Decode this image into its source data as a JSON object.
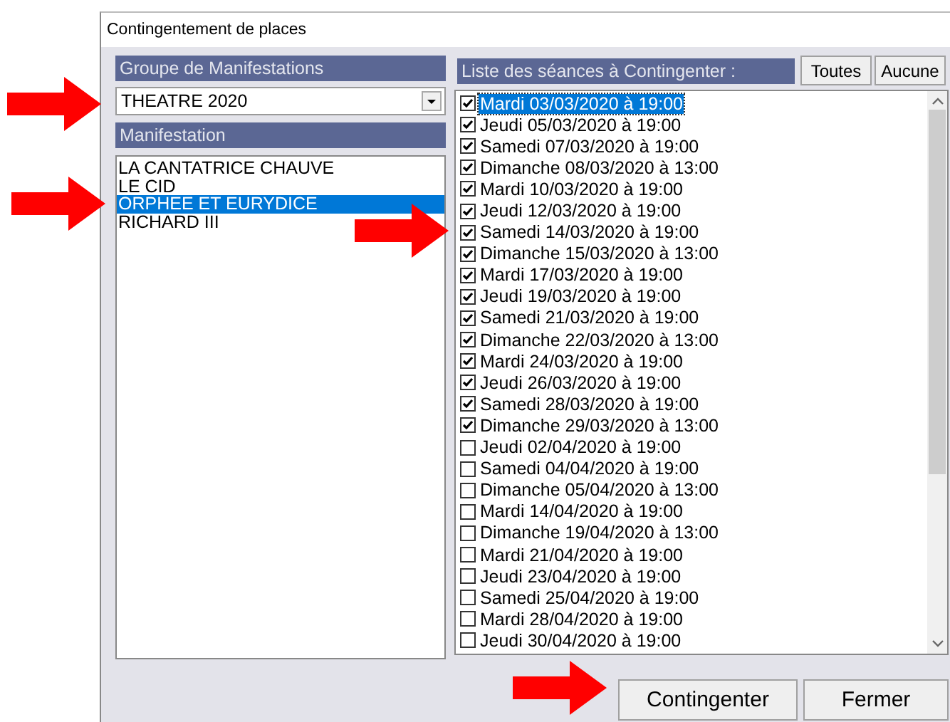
{
  "window": {
    "title": "Contingentement de places"
  },
  "group": {
    "header": "Groupe de Manifestations",
    "value": "THEATRE 2020"
  },
  "manifestations": {
    "header": "Manifestation",
    "items": [
      {
        "label": "LA CANTATRICE CHAUVE",
        "selected": false
      },
      {
        "label": "LE CID",
        "selected": false
      },
      {
        "label": "ORPHEE ET EURYDICE",
        "selected": true
      },
      {
        "label": "RICHARD III",
        "selected": false
      }
    ]
  },
  "sessions": {
    "header": "Liste des séances à Contingenter :",
    "buttons": [
      "Toutes",
      "Aucune"
    ],
    "items": [
      {
        "label": "Mardi 03/03/2020 à 19:00",
        "checked": true,
        "selected": true
      },
      {
        "label": "Jeudi 05/03/2020 à 19:00",
        "checked": true,
        "selected": false
      },
      {
        "label": "Samedi 07/03/2020 à 19:00",
        "checked": true,
        "selected": false
      },
      {
        "label": "Dimanche 08/03/2020 à 13:00",
        "checked": true,
        "selected": false
      },
      {
        "label": "Mardi 10/03/2020 à 19:00",
        "checked": true,
        "selected": false
      },
      {
        "label": "Jeudi 12/03/2020 à 19:00",
        "checked": true,
        "selected": false
      },
      {
        "label": "Samedi 14/03/2020 à 19:00",
        "checked": true,
        "selected": false
      },
      {
        "label": "Dimanche 15/03/2020 à 13:00",
        "checked": true,
        "selected": false
      },
      {
        "label": "Mardi 17/03/2020 à 19:00",
        "checked": true,
        "selected": false
      },
      {
        "label": "Jeudi 19/03/2020 à 19:00",
        "checked": true,
        "selected": false
      },
      {
        "label": "Samedi 21/03/2020 à 19:00",
        "checked": true,
        "selected": false
      },
      {
        "label": "Dimanche 22/03/2020 à 13:00",
        "checked": true,
        "selected": false
      },
      {
        "label": "Mardi 24/03/2020 à 19:00",
        "checked": true,
        "selected": false
      },
      {
        "label": "Jeudi 26/03/2020 à 19:00",
        "checked": true,
        "selected": false
      },
      {
        "label": "Samedi 28/03/2020 à 19:00",
        "checked": true,
        "selected": false
      },
      {
        "label": "Dimanche 29/03/2020 à 13:00",
        "checked": true,
        "selected": false
      },
      {
        "label": "Jeudi 02/04/2020 à 19:00",
        "checked": false,
        "selected": false
      },
      {
        "label": "Samedi 04/04/2020 à 19:00",
        "checked": false,
        "selected": false
      },
      {
        "label": "Dimanche 05/04/2020 à 13:00",
        "checked": false,
        "selected": false
      },
      {
        "label": "Mardi 14/04/2020 à 19:00",
        "checked": false,
        "selected": false
      },
      {
        "label": "Dimanche 19/04/2020 à 13:00",
        "checked": false,
        "selected": false
      },
      {
        "label": "Mardi 21/04/2020 à 19:00",
        "checked": false,
        "selected": false
      },
      {
        "label": "Jeudi 23/04/2020 à 19:00",
        "checked": false,
        "selected": false
      },
      {
        "label": "Samedi 25/04/2020 à 19:00",
        "checked": false,
        "selected": false
      },
      {
        "label": "Mardi 28/04/2020 à 19:00",
        "checked": false,
        "selected": false
      },
      {
        "label": "Jeudi 30/04/2020 à 19:00",
        "checked": false,
        "selected": false
      }
    ]
  },
  "buttons": [
    "Contingenter",
    "Fermer"
  ]
}
